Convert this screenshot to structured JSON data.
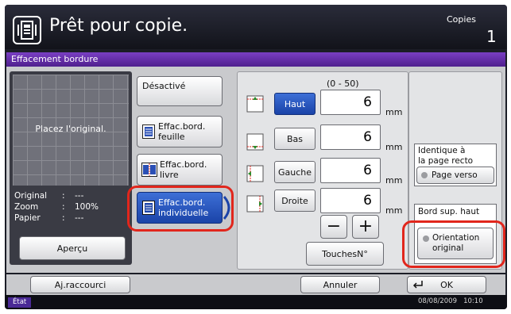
{
  "header": {
    "title": "Prêt pour copie.",
    "copies_label": "Copies",
    "copies_count": "1"
  },
  "panel": {
    "title": "Effacement bordure",
    "preview_text": "Placez l'original.",
    "info": {
      "original_label": "Original",
      "original_value": "---",
      "zoom_label": "Zoom",
      "zoom_value": "100%",
      "paper_label": "Papier",
      "paper_value": "---",
      "separator": ":"
    },
    "preview_button": "Aperçu"
  },
  "modes": {
    "off": "Désactivé",
    "sheet": [
      "Effac.bord.",
      "feuille"
    ],
    "book": [
      "Effac.bord.",
      "livre"
    ],
    "individual": [
      "Effac.bord.",
      "individuelle"
    ]
  },
  "margins": {
    "range": "(0 - 50)",
    "unit": "mm",
    "top": {
      "label": "Haut",
      "value": "6"
    },
    "bottom": {
      "label": "Bas",
      "value": "6"
    },
    "left": {
      "label": "Gauche",
      "value": "6"
    },
    "right": {
      "label": "Droite",
      "value": "6"
    },
    "minus": "−",
    "plus": "+",
    "numkeys": "TouchesN°"
  },
  "back": {
    "label": [
      "Identique à",
      "la page recto"
    ],
    "button": "Page verso"
  },
  "orientation": {
    "label": "Bord sup. haut",
    "button": [
      "Orientation",
      "original"
    ]
  },
  "footer": {
    "shortcut": "Aj.raccourci",
    "cancel": "Annuler",
    "ok": "OK"
  },
  "status": {
    "state": "État",
    "date": "08/08/2009",
    "time": "10:10"
  },
  "colors": {
    "selected": "#1a43a8",
    "highlight": "#e1261c",
    "title_bar": "#5a2aa0"
  }
}
